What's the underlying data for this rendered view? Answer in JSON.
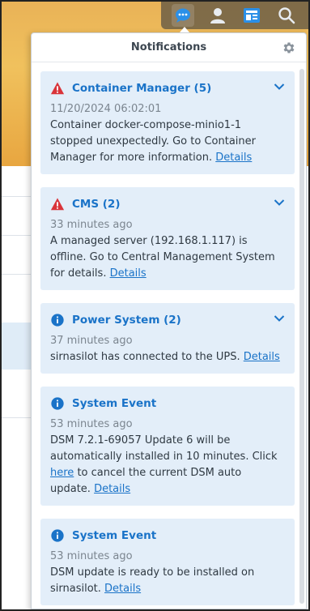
{
  "panel": {
    "title": "Notifications",
    "topbar_icons": [
      "chat-icon",
      "user-icon",
      "widgets-icon",
      "search-icon"
    ]
  },
  "notifications": [
    {
      "icon": "warning-icon",
      "title": "Container Manager (5)",
      "time": "11/20/2024 06:02:01",
      "message": "Container docker-compose-minio1-1 stopped unexpectedly. Go to Container Manager for more information.",
      "details": "Details",
      "expandable": true
    },
    {
      "icon": "warning-icon",
      "title": "CMS (2)",
      "time": "33 minutes ago",
      "message": "A managed server (192.168.1.117) is offline. Go to Central Management System for details.",
      "details": "Details",
      "expandable": true
    },
    {
      "icon": "info-icon",
      "title": "Power System (2)",
      "time": "37 minutes ago",
      "message": "sirnasilot has connected to the UPS.",
      "details": "Details",
      "expandable": true
    },
    {
      "icon": "info-icon",
      "title": "System Event",
      "time": "53 minutes ago",
      "message_a": "DSM 7.2.1-69057 Update 6 will be automatically installed in 10 minutes. Click",
      "here": "here",
      "message_b": "to cancel the current DSM auto update.",
      "details": "Details",
      "expandable": false
    },
    {
      "icon": "info-icon",
      "title": "System Event",
      "time": "53 minutes ago",
      "message": "DSM update is ready to be installed on sirnasilot.",
      "details": "Details",
      "expandable": false
    }
  ],
  "colors": {
    "accent": "#1a73c8",
    "warning": "#d9343a",
    "card_bg": "#e3eef9"
  }
}
